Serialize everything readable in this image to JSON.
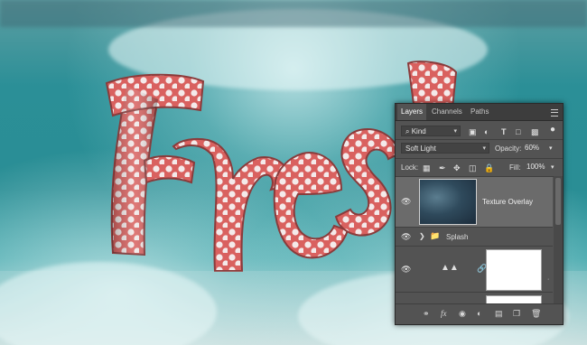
{
  "canvas": {
    "word": "Fresh"
  },
  "layers_panel": {
    "tabs": [
      {
        "label": "Layers",
        "active": true
      },
      {
        "label": "Channels",
        "active": false
      },
      {
        "label": "Paths",
        "active": false
      }
    ],
    "filter_kind": "Kind",
    "blend_mode": "Soft Light",
    "opacity_label": "Opacity:",
    "opacity_value": "60%",
    "lock_label": "Lock:",
    "fill_label": "Fill:",
    "fill_value": "100%",
    "layers": [
      {
        "name": "Texture Overlay",
        "type": "image",
        "visible": true,
        "selected": true
      },
      {
        "name": "Splash",
        "type": "group",
        "visible": true,
        "selected": false
      },
      {
        "name": "",
        "type": "levels-adjustment",
        "visible": true,
        "selected": false
      },
      {
        "name": "",
        "type": "adjustment",
        "visible": false,
        "selected": false
      }
    ],
    "footer_icons": [
      "link-icon",
      "fx-icon",
      "mask-icon",
      "adjustment-icon",
      "folder-icon",
      "new-layer-icon",
      "trash-icon"
    ]
  },
  "colors": {
    "panel_bg": "#535353",
    "tab_bar": "#3d3d3d",
    "selected_row": "#6b6b6b",
    "letter_pink": "#e06a6a"
  }
}
